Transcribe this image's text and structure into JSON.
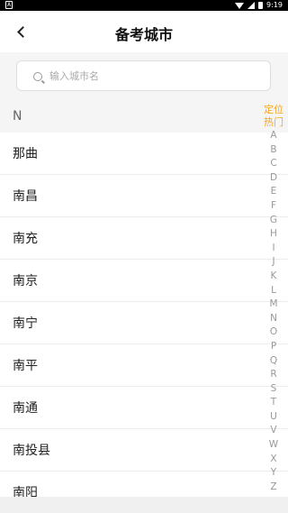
{
  "status_bar": {
    "notification_glyph": "A",
    "time": "9:19"
  },
  "header": {
    "title": "备考城市"
  },
  "search": {
    "placeholder": "输入城市名"
  },
  "section": {
    "letter": "N"
  },
  "cities": [
    "那曲",
    "南昌",
    "南充",
    "南京",
    "南宁",
    "南平",
    "南通",
    "南投县",
    "南阳"
  ],
  "index_bar": {
    "top_items": [
      "定位",
      "热门"
    ],
    "letters": [
      "A",
      "B",
      "C",
      "D",
      "E",
      "F",
      "G",
      "H",
      "I",
      "J",
      "K",
      "L",
      "M",
      "N",
      "O",
      "P",
      "Q",
      "R",
      "S",
      "T",
      "U",
      "V",
      "W",
      "X",
      "Y",
      "Z"
    ],
    "accent_color": "#f5a623"
  }
}
